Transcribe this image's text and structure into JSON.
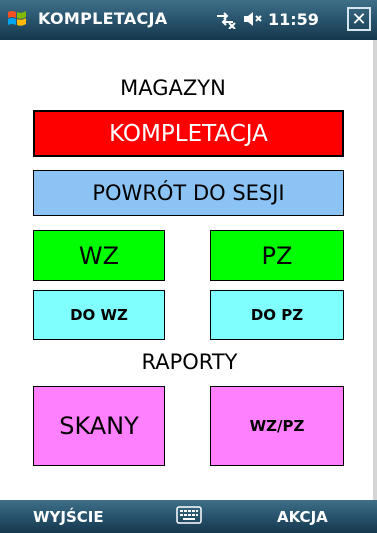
{
  "titlebar": {
    "title": "KOMPLETACJA",
    "time": "11:59",
    "close": "✕",
    "connectivity_icon": "connectivity-icon",
    "volume_icon": "speaker-muted-icon"
  },
  "sections": {
    "magazyn": "MAGAZYN",
    "raporty": "RAPORTY"
  },
  "buttons": {
    "kompletacja": "KOMPLETACJA",
    "powrot": "POWRÓT DO SESJI",
    "wz": "WZ",
    "pz": "PZ",
    "do_wz": "DO WZ",
    "do_pz": "DO PZ",
    "skany": "SKANY",
    "wz_pz": "WZ/PZ"
  },
  "softkeys": {
    "left": "WYJŚCIE",
    "right": "AKCJA",
    "keyboard_icon": "keyboard-icon"
  },
  "colors": {
    "kompletacja": "#ff0000",
    "powrot": "#8cc3f5",
    "wz_pz_green": "#00ff00",
    "do_cyan": "#80ffff",
    "raporty_magenta": "#ff80ff"
  }
}
